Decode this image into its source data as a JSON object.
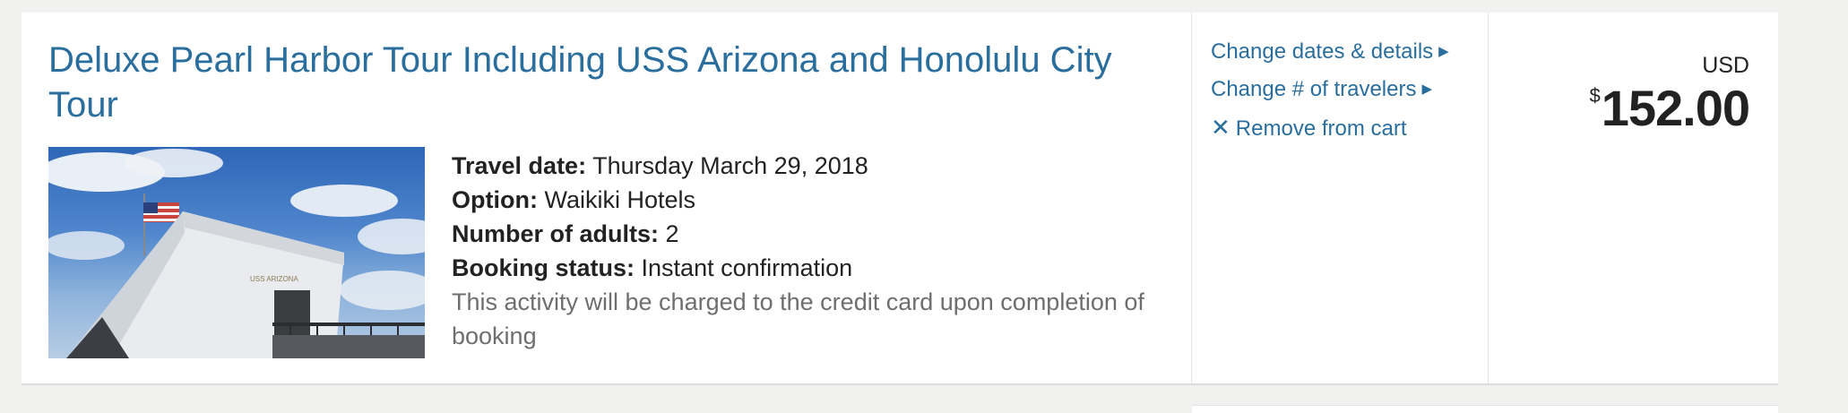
{
  "item": {
    "title": "Deluxe Pearl Harbor Tour Including USS Arizona and Honolulu City Tour",
    "details": {
      "travel_date_label": "Travel date:",
      "travel_date_value": "Thursday March 29, 2018",
      "option_label": "Option:",
      "option_value": "Waikiki Hotels",
      "adults_label": "Number of adults:",
      "adults_value": "2",
      "status_label": "Booking status:",
      "status_value": "Instant confirmation",
      "note": "This activity will be charged to the credit card upon completion of booking"
    }
  },
  "actions": {
    "change_dates": "Change dates & details",
    "change_travelers": "Change # of travelers",
    "remove": "Remove from cart"
  },
  "price": {
    "currency": "USD",
    "symbol": "$",
    "amount": "152.00"
  },
  "icons": {
    "triangle": "caret-right-icon",
    "remove": "close-icon"
  },
  "colors": {
    "link": "#2a6e9e",
    "text": "#222222",
    "muted": "#6e6e6e",
    "background": "#f1f1ef"
  }
}
